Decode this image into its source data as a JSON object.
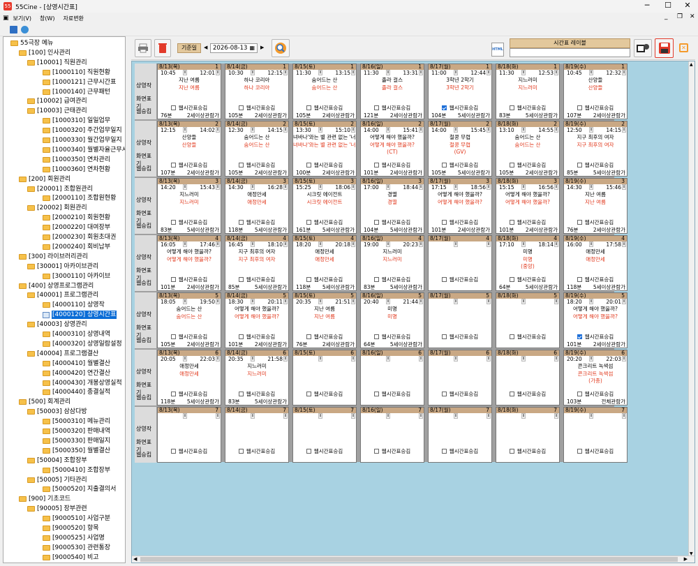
{
  "window": {
    "title": "55Cine - [상영시간표]",
    "minimize": "─",
    "maximize": "☐",
    "close": "✕"
  },
  "menu": {
    "items": [
      "보기(V)",
      "창(W)",
      "자료변환"
    ],
    "mdi_min": "_",
    "mdi_restore": "❐",
    "mdi_close": "✕"
  },
  "tree": [
    {
      "label": "55극장 메뉴",
      "lvl": 0,
      "t": "f"
    },
    {
      "label": "[100] 인사관리",
      "lvl": 1,
      "t": "f"
    },
    {
      "label": "[10001] 직원관리",
      "lvl": 2,
      "t": "f"
    },
    {
      "label": "[1000110] 직원현황",
      "lvl": 3,
      "t": "f"
    },
    {
      "label": "[1000121] 근무시간표",
      "lvl": 3,
      "t": "f"
    },
    {
      "label": "[1000140] 근무패턴",
      "lvl": 3,
      "t": "f"
    },
    {
      "label": "[10002] 급여관리",
      "lvl": 2,
      "t": "f"
    },
    {
      "label": "[10003] 근태관리",
      "lvl": 2,
      "t": "f"
    },
    {
      "label": "[1000310] 일일업무",
      "lvl": 3,
      "t": "f"
    },
    {
      "label": "[1000320] 주간업무일지",
      "lvl": 3,
      "t": "f"
    },
    {
      "label": "[1000330] 월간업무일지",
      "lvl": 3,
      "t": "f"
    },
    {
      "label": "[1000340] 월별자율근무시간",
      "lvl": 3,
      "t": "f"
    },
    {
      "label": "[1000350] 연차관리",
      "lvl": 3,
      "t": "f"
    },
    {
      "label": "[1000360] 연차현황",
      "lvl": 3,
      "t": "f"
    },
    {
      "label": "[200] 회원관리",
      "lvl": 1,
      "t": "f"
    },
    {
      "label": "[20001] 조합원관리",
      "lvl": 2,
      "t": "f"
    },
    {
      "label": "[2000110] 조합원현황",
      "lvl": 3,
      "t": "f"
    },
    {
      "label": "[20002] 회원관리",
      "lvl": 2,
      "t": "f"
    },
    {
      "label": "[2000210] 회원현황",
      "lvl": 3,
      "t": "f"
    },
    {
      "label": "[2000220] 대여장부",
      "lvl": 3,
      "t": "f"
    },
    {
      "label": "[2000230] 회원초대권",
      "lvl": 3,
      "t": "f"
    },
    {
      "label": "[2000240] 회비납부",
      "lvl": 3,
      "t": "f"
    },
    {
      "label": "[300] 라이브러리관리",
      "lvl": 1,
      "t": "f"
    },
    {
      "label": "[30001] 아카이브관리",
      "lvl": 2,
      "t": "f"
    },
    {
      "label": "[3000110] 아카이브",
      "lvl": 3,
      "t": "f"
    },
    {
      "label": "[400] 상영프로그램관리",
      "lvl": 1,
      "t": "f"
    },
    {
      "label": "[40001] 프로그램관리",
      "lvl": 2,
      "t": "f"
    },
    {
      "label": "[4000110] 상영작",
      "lvl": 3,
      "t": "f"
    },
    {
      "label": "[4000120] 상영시간표",
      "lvl": 3,
      "t": "l",
      "sel": true
    },
    {
      "label": "[40003] 상영관리",
      "lvl": 2,
      "t": "f"
    },
    {
      "label": "[4000310] 상영내역",
      "lvl": 3,
      "t": "f"
    },
    {
      "label": "[4000320] 상영일람설정",
      "lvl": 3,
      "t": "f"
    },
    {
      "label": "[40004] 프로그램결산",
      "lvl": 2,
      "t": "f"
    },
    {
      "label": "[4000410] 월별결산",
      "lvl": 3,
      "t": "f"
    },
    {
      "label": "[4000420] 연간결산",
      "lvl": 3,
      "t": "f"
    },
    {
      "label": "[4000430] 개봉상영실적",
      "lvl": 3,
      "t": "f"
    },
    {
      "label": "[4000440] 종결실적",
      "lvl": 3,
      "t": "f"
    },
    {
      "label": "[500] 회계관리",
      "lvl": 1,
      "t": "f"
    },
    {
      "label": "[50003] 삼삼다방",
      "lvl": 2,
      "t": "f"
    },
    {
      "label": "[5000310] 메뉴관리",
      "lvl": 3,
      "t": "f"
    },
    {
      "label": "[5000320] 판매내역",
      "lvl": 3,
      "t": "f"
    },
    {
      "label": "[5000330] 판매일지",
      "lvl": 3,
      "t": "f"
    },
    {
      "label": "[5000350] 월별결산",
      "lvl": 3,
      "t": "f"
    },
    {
      "label": "[50004] 조합장부",
      "lvl": 2,
      "t": "f"
    },
    {
      "label": "[5000410] 조합장부",
      "lvl": 3,
      "t": "f"
    },
    {
      "label": "[50005] 기타관리",
      "lvl": 2,
      "t": "f"
    },
    {
      "label": "[5000520] 지출결의서",
      "lvl": 3,
      "t": "f"
    },
    {
      "label": "[900] 기초코드",
      "lvl": 1,
      "t": "f"
    },
    {
      "label": "[90005] 장부관련",
      "lvl": 2,
      "t": "f"
    },
    {
      "label": "[9000510] 사업구분",
      "lvl": 3,
      "t": "f"
    },
    {
      "label": "[9000520] 항목",
      "lvl": 3,
      "t": "f"
    },
    {
      "label": "[9000525] 사업명",
      "lvl": 3,
      "t": "f"
    },
    {
      "label": "[9000530] 관련통장",
      "lvl": 3,
      "t": "f"
    },
    {
      "label": "[9000540] 비고",
      "lvl": 3,
      "t": "f"
    }
  ],
  "toolbar": {
    "date_label": "기준일",
    "date_value": "2026-08-13",
    "layout_label": "시간표 레이블",
    "prev": "◀",
    "next": "▶",
    "html_label": "HTML"
  },
  "row_labels": {
    "movie": "상영작",
    "display": "화면표기",
    "web": "웹승킴"
  },
  "checkbox_label": "웹시간표승김",
  "dates": [
    "8/13(목)",
    "8/14(금)",
    "8/15(토)",
    "8/16(일)",
    "8/17(월)",
    "8/18(화)",
    "8/19(수)"
  ],
  "rows": [
    {
      "n": "1",
      "cells": [
        {
          "s": "10:45",
          "e": "12:01",
          "t": "지난 여름",
          "d": "지난 여름",
          "rt": "76분",
          "g": "2세이상관람가"
        },
        {
          "s": "10:30",
          "e": "12:15",
          "t": "하나 코리아",
          "d": "하나 코리아",
          "rt": "105분",
          "g": "2세이상관람가"
        },
        {
          "s": "11:30",
          "e": "13:15",
          "t": "숨어드는 산",
          "d": "숨어드는 산",
          "rt": "105분",
          "g": "2세이상관람가"
        },
        {
          "s": "11:30",
          "e": "13:31",
          "t": "졸라 걸스",
          "d": "졸라 걸스",
          "rt": "121분",
          "g": "2세이상관람가"
        },
        {
          "s": "11:00",
          "e": "12:44",
          "t": "3학년 2학기",
          "d": "3학년 2학기",
          "rt": "104분",
          "g": "5세이상관람가",
          "chk": true
        },
        {
          "s": "11:30",
          "e": "12:53",
          "t": "지느러미",
          "d": "지느러미",
          "rt": "83분",
          "g": "5세이상관람가"
        },
        {
          "s": "10:45",
          "e": "12:32",
          "t": "산양들",
          "d": "산양들",
          "rt": "107분",
          "g": "2세이상관람가"
        }
      ]
    },
    {
      "n": "2",
      "cells": [
        {
          "s": "12:15",
          "e": "14:02",
          "t": "산양들",
          "d": "산양들",
          "rt": "107분",
          "g": "2세이상관람가"
        },
        {
          "s": "12:30",
          "e": "14:15",
          "t": "숨어드는 산",
          "d": "숨어드는 산",
          "rt": "105분",
          "g": "2세이상관람가"
        },
        {
          "s": "13:30",
          "e": "15:10",
          "t": "녀바나'와는 별 관련 없는 '너바",
          "d": "녀바나'와는 별 관련 없는 '너바",
          "rt": "100분",
          "g": "2세이상관람가"
        },
        {
          "s": "14:00",
          "e": "15:41",
          "t": "어떻게 해야 했을까?",
          "d": "어떻게 해야 했을까?",
          "x": "(CT)",
          "rt": "101분",
          "g": "2세이상관람가"
        },
        {
          "s": "14:00",
          "e": "15:45",
          "t": "철콩 무렵",
          "d": "철콩 무렵",
          "x": "(GV)",
          "rt": "105분",
          "g": "5세이상관람가"
        },
        {
          "s": "13:10",
          "e": "14:55",
          "t": "숨어드는 산",
          "d": "숨어드는 산",
          "rt": "105분",
          "g": "2세이상관람가"
        },
        {
          "s": "12:50",
          "e": "14:15",
          "t": "지구 최후의 여자",
          "d": "지구 최후의 여자",
          "rt": "85분",
          "g": "5세이상관람가"
        }
      ]
    },
    {
      "n": "3",
      "cells": [
        {
          "s": "14:20",
          "e": "15:43",
          "t": "지느러미",
          "d": "지느러미",
          "rt": "83분",
          "g": "5세이상관람가"
        },
        {
          "s": "14:30",
          "e": "16:28",
          "t": "애정만세",
          "d": "애정만세",
          "rt": "118분",
          "g": "5세이상관람가"
        },
        {
          "s": "15:25",
          "e": "18:06",
          "t": "시크릿 에이전트",
          "d": "시크릿 에이전트",
          "rt": "161분",
          "g": "5세이상관람가"
        },
        {
          "s": "17:00",
          "e": "18:44",
          "t": "경멸",
          "d": "경멸",
          "rt": "104분",
          "g": "5세이상관람가"
        },
        {
          "s": "17:15",
          "e": "18:56",
          "t": "어떻게 해야 했을까?",
          "d": "어떻게 해야 했을까?",
          "rt": "101분",
          "g": "2세이상관람가"
        },
        {
          "s": "15:15",
          "e": "16:56",
          "t": "어떻게 해야 했을까?",
          "d": "어떻게 해야 했을까?",
          "rt": "101분",
          "g": "2세이상관람가"
        },
        {
          "s": "14:30",
          "e": "15:46",
          "t": "지난 여름",
          "d": "지난 여름",
          "rt": "76분",
          "g": "2세이상관람가"
        }
      ]
    },
    {
      "n": "4",
      "cells": [
        {
          "s": "16:05",
          "e": "17:46",
          "t": "어떻게 해야 했을까?",
          "d": "어떻게 해야 했을까?",
          "rt": "101분",
          "g": "2세이상관람가"
        },
        {
          "s": "16:45",
          "e": "18:10",
          "t": "지구 최후의 여자",
          "d": "지구 최후의 여자",
          "rt": "85분",
          "g": "5세이상관람가"
        },
        {
          "s": "18:20",
          "e": "20:18",
          "t": "애정만세",
          "d": "애정만세",
          "rt": "118분",
          "g": "5세이상관람가"
        },
        {
          "s": "19:00",
          "e": "20:23",
          "t": "지느러미",
          "d": "지느러미",
          "rt": "83분",
          "g": "5세이상관람가"
        },
        {
          "s": "",
          "e": "",
          "t": "",
          "d": "",
          "rt": "",
          "g": ""
        },
        {
          "s": "17:10",
          "e": "18:14",
          "t": "미명",
          "d": "미명",
          "x": "(중앙)",
          "rt": "64분",
          "g": "5세이상관람가"
        },
        {
          "s": "16:00",
          "e": "17:58",
          "t": "애정만세",
          "d": "애정만세",
          "rt": "118분",
          "g": "5세이상관람가"
        }
      ]
    },
    {
      "n": "5",
      "cells": [
        {
          "s": "18:05",
          "e": "19:50",
          "t": "숨어드는 산",
          "d": "숨어드는 산",
          "rt": "105분",
          "g": "2세이상관람가"
        },
        {
          "s": "18:30",
          "e": "20:11",
          "t": "어떻게 해야 했을까?",
          "d": "어떻게 해야 했을까?",
          "rt": "101분",
          "g": "2세이상관람가"
        },
        {
          "s": "20:35",
          "e": "21:51",
          "t": "지난 여름",
          "d": "지난 여름",
          "rt": "76분",
          "g": "2세이상관람가"
        },
        {
          "s": "20:40",
          "e": "21:44",
          "t": "미명",
          "d": "미명",
          "rt": "64분",
          "g": "5세이상관람가"
        },
        {
          "s": "",
          "e": "",
          "t": "",
          "d": "",
          "rt": "",
          "g": ""
        },
        {
          "s": "",
          "e": "",
          "t": "",
          "d": "",
          "rt": "",
          "g": ""
        },
        {
          "s": "18:20",
          "e": "20:01",
          "t": "어떻게 해야 했을까?",
          "d": "어떻게 해야 했을까?",
          "rt": "101분",
          "g": "2세이상관람가",
          "chk": true
        }
      ]
    },
    {
      "n": "6",
      "cells": [
        {
          "s": "20:05",
          "e": "22:03",
          "t": "애정만세",
          "d": "애정만세",
          "rt": "118분",
          "g": "5세이상관람가"
        },
        {
          "s": "20:35",
          "e": "21:58",
          "t": "지느러미",
          "d": "지느러미",
          "rt": "83분",
          "g": "5세이상관람가"
        },
        {
          "s": "",
          "e": "",
          "t": "",
          "d": "",
          "rt": "",
          "g": ""
        },
        {
          "s": "",
          "e": "",
          "t": "",
          "d": "",
          "rt": "",
          "g": ""
        },
        {
          "s": "",
          "e": "",
          "t": "",
          "d": "",
          "rt": "",
          "g": ""
        },
        {
          "s": "",
          "e": "",
          "t": "",
          "d": "",
          "rt": "",
          "g": ""
        },
        {
          "s": "20:20",
          "e": "22:03",
          "t": "콘크리트 녹색섬",
          "d": "콘크리트 녹색섬",
          "x": "(가종)",
          "rt": "103분",
          "g": "전체관람가"
        }
      ]
    },
    {
      "n": "7",
      "cells": [
        {
          "s": "",
          "e": "",
          "t": "",
          "d": "",
          "rt": "",
          "g": ""
        },
        {
          "s": "",
          "e": "",
          "t": "",
          "d": "",
          "rt": "",
          "g": ""
        },
        {
          "s": "",
          "e": "",
          "t": "",
          "d": "",
          "rt": "",
          "g": ""
        },
        {
          "s": "",
          "e": "",
          "t": "",
          "d": "",
          "rt": "",
          "g": ""
        },
        {
          "s": "",
          "e": "",
          "t": "",
          "d": "",
          "rt": "",
          "g": ""
        },
        {
          "s": "",
          "e": "",
          "t": "",
          "d": "",
          "rt": "",
          "g": ""
        },
        {
          "s": "",
          "e": "",
          "t": "",
          "d": "",
          "rt": "",
          "g": ""
        }
      ]
    }
  ],
  "colors": {
    "header_tan": "#c9a884",
    "accent_red": "#e1371b",
    "selection": "#0a6cd6",
    "grid_bg": "#a8d2e2"
  }
}
